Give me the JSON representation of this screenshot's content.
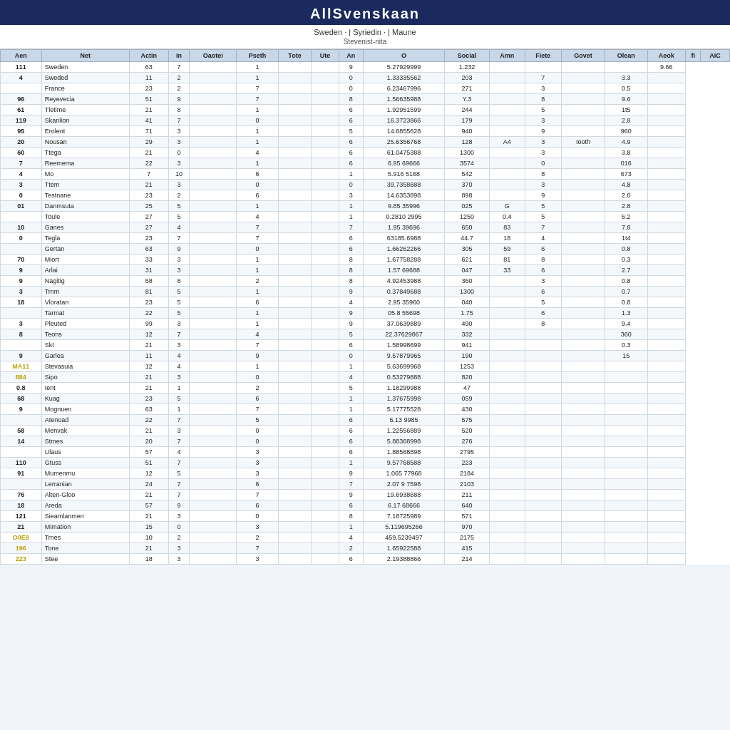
{
  "header": {
    "title": "AllSvenskaan",
    "subtitle": "Sweden  ·  |  Syriedin  ·  |  Maune",
    "subtitle2": "Stevenist-nita"
  },
  "columns": [
    "Aen",
    "Net",
    "Actin",
    "In",
    "Oaotei",
    "Pseth",
    "Tote",
    "Ute",
    "An",
    "O",
    "Social",
    "Amn",
    "Fiete",
    "Govet",
    "Olean",
    "Aeok",
    "fi",
    "AIC"
  ],
  "rows": [
    {
      "rank": "111",
      "name": "Sweden",
      "c1": "63",
      "c2": "7",
      "c3": "",
      "c4": "1",
      "c5": "",
      "c6": "",
      "c7": "9",
      "c8": "5.27929999",
      "c9": "1.232",
      "c10": "",
      "c11": "",
      "c12": "",
      "c13": "",
      "c14": "9.66"
    },
    {
      "rank": "4",
      "name": "Sweded",
      "c1": "11",
      "c2": "2",
      "c3": "",
      "c4": "1",
      "c5": "",
      "c6": "",
      "c7": "0",
      "c8": "1.33335562",
      "c9": "203",
      "c10": "",
      "c11": "7",
      "c12": "",
      "c13": "3.3"
    },
    {
      "rank": "",
      "name": "France",
      "c1": "23",
      "c2": "2",
      "c3": "",
      "c4": "7",
      "c5": "",
      "c6": "",
      "c7": "0",
      "c8": "6.23467996",
      "c9": "271",
      "c10": "",
      "c11": "3",
      "c12": "",
      "c13": "0.5"
    },
    {
      "rank": "96",
      "name": "Reyevecia",
      "c1": "51",
      "c2": "9",
      "c3": "",
      "c4": "7",
      "c5": "",
      "c6": "",
      "c7": "8",
      "c8": "1.56635988",
      "c9": "Y.3",
      "c10": "",
      "c11": "8",
      "c12": "",
      "c13": "9.6"
    },
    {
      "rank": "61",
      "name": "Tletime",
      "c1": "21",
      "c2": "8",
      "c3": "",
      "c4": "1",
      "c5": "",
      "c6": "",
      "c7": "6",
      "c8": "1.92951599",
      "c9": "244",
      "c10": "",
      "c11": "5",
      "c12": "",
      "c13": "1t5"
    },
    {
      "rank": "119",
      "name": "Skanlion",
      "c1": "41",
      "c2": "7",
      "c3": "",
      "c4": "0",
      "c5": "",
      "c6": "",
      "c7": "6",
      "c8": "16.3723866",
      "c9": "179",
      "c10": "",
      "c11": "3",
      "c12": "",
      "c13": "2.8"
    },
    {
      "rank": "95",
      "name": "Erolent",
      "c1": "71",
      "c2": "3",
      "c3": "",
      "c4": "1",
      "c5": "",
      "c6": "",
      "c7": "5",
      "c8": "14.6855628",
      "c9": "940",
      "c10": "",
      "c11": "9",
      "c12": "",
      "c13": "960"
    },
    {
      "rank": "20",
      "name": "Nousan",
      "c1": "29",
      "c2": "3",
      "c3": "",
      "c4": "1",
      "c5": "",
      "c6": "",
      "c7": "6",
      "c8": "25.6356768",
      "c9": "128",
      "c10": "A4",
      "c11": "3",
      "c12": "Iooth",
      "c13": "4.9"
    },
    {
      "rank": "60",
      "name": "Ttega",
      "c1": "21",
      "c2": "0",
      "c3": "",
      "c4": "4",
      "c5": "",
      "c6": "",
      "c7": "6",
      "c8": "61.0475388",
      "c9": "1300",
      "c10": "",
      "c11": "3",
      "c12": "",
      "c13": "3.8"
    },
    {
      "rank": "7",
      "name": "Reemema",
      "c1": "22",
      "c2": "3",
      "c3": "",
      "c4": "1",
      "c5": "",
      "c6": "",
      "c7": "6",
      "c8": "6.95 69666",
      "c9": "3574",
      "c10": "",
      "c11": "0",
      "c12": "",
      "c13": "016"
    },
    {
      "rank": "4",
      "name": "Mo",
      "c1": "7",
      "c2": "10",
      "c3": "",
      "c4": "6",
      "c5": "",
      "c6": "",
      "c7": "1",
      "c8": "5.916 5168",
      "c9": "542",
      "c10": "",
      "c11": "8",
      "c12": "",
      "c13": "673"
    },
    {
      "rank": "3",
      "name": "Ttem",
      "c1": "21",
      "c2": "3",
      "c3": "",
      "c4": "0",
      "c5": "",
      "c6": "",
      "c7": "0",
      "c8": "39.7358688",
      "c9": "370",
      "c10": "",
      "c11": "3",
      "c12": "",
      "c13": "4.8"
    },
    {
      "rank": "0",
      "name": "Testnane",
      "c1": "23",
      "c2": "2",
      "c3": "",
      "c4": "6",
      "c5": "",
      "c6": "",
      "c7": "3",
      "c8": "14.6353898",
      "c9": "898",
      "c10": "",
      "c11": "9",
      "c12": "",
      "c13": "2.0"
    },
    {
      "rank": "01",
      "name": "Danmsuta",
      "c1": "25",
      "c2": "5",
      "c3": "",
      "c4": "1",
      "c5": "",
      "c6": "",
      "c7": "1",
      "c8": "9.85 35996",
      "c9": "025",
      "c10": "G",
      "c11": "5",
      "c12": "",
      "c13": "2.8"
    },
    {
      "rank": "",
      "name": "Toule",
      "c1": "27",
      "c2": "5",
      "c3": "",
      "c4": "4",
      "c5": "",
      "c6": "",
      "c7": "1",
      "c8": "0.2810 2995",
      "c9": "1250",
      "c10": "0.4",
      "c11": "5",
      "c12": "",
      "c13": "6.2"
    },
    {
      "rank": "10",
      "name": "Ganes",
      "c1": "27",
      "c2": "4",
      "c3": "",
      "c4": "7",
      "c5": "",
      "c6": "",
      "c7": "7",
      "c8": "1.95 39696",
      "c9": "650",
      "c10": "83",
      "c11": "7",
      "c12": "",
      "c13": "7.8"
    },
    {
      "rank": "0",
      "name": "Tegla",
      "c1": "23",
      "c2": "7",
      "c3": "",
      "c4": "7",
      "c5": "",
      "c6": "",
      "c7": "6",
      "c8": "63185.6988",
      "c9": "44.7",
      "c10": "18",
      "c11": "4",
      "c12": "",
      "c13": "1t4"
    },
    {
      "rank": "",
      "name": "Gertan",
      "c1": "63",
      "c2": "9",
      "c3": "",
      "c4": "0",
      "c5": "",
      "c6": "",
      "c7": "6",
      "c8": "1.66262266",
      "c9": "305",
      "c10": "59",
      "c11": "6",
      "c12": "",
      "c13": "0.8"
    },
    {
      "rank": "70",
      "name": "Miort",
      "c1": "33",
      "c2": "3",
      "c3": "",
      "c4": "1",
      "c5": "",
      "c6": "",
      "c7": "8",
      "c8": "1.67758288",
      "c9": "621",
      "c10": "81",
      "c11": "8",
      "c12": "",
      "c13": "0.3"
    },
    {
      "rank": "9",
      "name": "Arlai",
      "c1": "31",
      "c2": "3",
      "c3": "",
      "c4": "1",
      "c5": "",
      "c6": "",
      "c7": "8",
      "c8": "1.57 69688",
      "c9": "047",
      "c10": "33",
      "c11": "6",
      "c12": "",
      "c13": "2.7"
    },
    {
      "rank": "9",
      "name": "Nagitig",
      "c1": "58",
      "c2": "8",
      "c3": "",
      "c4": "2",
      "c5": "",
      "c6": "",
      "c7": "8",
      "c8": "4.92453988",
      "c9": "360",
      "c10": "",
      "c11": "3",
      "c12": "",
      "c13": "0.8"
    },
    {
      "rank": "3",
      "name": "Trnm",
      "c1": "81",
      "c2": "5",
      "c3": "",
      "c4": "1",
      "c5": "",
      "c6": "",
      "c7": "9",
      "c8": "0.37849688",
      "c9": "1300",
      "c10": "",
      "c11": "6",
      "c12": "",
      "c13": "0.7"
    },
    {
      "rank": "18",
      "name": "Vloratan",
      "c1": "23",
      "c2": "5",
      "c3": "",
      "c4": "6",
      "c5": "",
      "c6": "",
      "c7": "4",
      "c8": "2.95 35960",
      "c9": "040",
      "c10": "",
      "c11": "5",
      "c12": "",
      "c13": "0.8"
    },
    {
      "rank": "",
      "name": "Tarmat",
      "c1": "22",
      "c2": "5",
      "c3": "",
      "c4": "1",
      "c5": "",
      "c6": "",
      "c7": "9",
      "c8": "05.8 55698",
      "c9": "1.75",
      "c10": "",
      "c11": "6",
      "c12": "",
      "c13": "1.3"
    },
    {
      "rank": "3",
      "name": "Pleuted",
      "c1": "99",
      "c2": "3",
      "c3": "",
      "c4": "1",
      "c5": "",
      "c6": "",
      "c7": "9",
      "c8": "37.0639889",
      "c9": "490",
      "c10": "",
      "c11": "8",
      "c12": "",
      "c13": "9.4"
    },
    {
      "rank": "8",
      "name": "Teons",
      "c1": "12",
      "c2": "7",
      "c3": "",
      "c4": "4",
      "c5": "",
      "c6": "",
      "c7": "5",
      "c8": "22.37629867",
      "c9": "332",
      "c10": "",
      "c11": "",
      "c12": "",
      "c13": "360"
    },
    {
      "rank": "",
      "name": "Skt",
      "c1": "21",
      "c2": "3",
      "c3": "",
      "c4": "7",
      "c5": "",
      "c6": "",
      "c7": "6",
      "c8": "1.58998699",
      "c9": "941",
      "c10": "",
      "c11": "",
      "c12": "",
      "c13": "0.3"
    },
    {
      "rank": "9",
      "name": "Garlea",
      "c1": "11",
      "c2": "4",
      "c3": "",
      "c4": "9",
      "c5": "",
      "c6": "",
      "c7": "0",
      "c8": "9.57879965",
      "c9": "190",
      "c10": "",
      "c11": "",
      "c12": "",
      "c13": "15"
    },
    {
      "rank": "MA11",
      "name": "Stevasuia",
      "c1": "12",
      "c2": "4",
      "c3": "",
      "c4": "1",
      "c5": "",
      "c6": "",
      "c7": "1",
      "c8": "5.63699968",
      "c9": "1253",
      "c10": "",
      "c11": "",
      "c12": "",
      "c13": ""
    },
    {
      "rank": "884",
      "name": "Sipo",
      "c1": "21",
      "c2": "3",
      "c3": "",
      "c4": "0",
      "c5": "",
      "c6": "",
      "c7": "4",
      "c8": "0.53279888",
      "c9": "820",
      "c10": "",
      "c11": "",
      "c12": "",
      "c13": ""
    },
    {
      "rank": "0.8",
      "name": "Ient",
      "c1": "21",
      "c2": "1",
      "c3": "",
      "c4": "2",
      "c5": "",
      "c6": "",
      "c7": "5",
      "c8": "1.18299988",
      "c9": "47",
      "c10": "",
      "c11": "",
      "c12": "",
      "c13": ""
    },
    {
      "rank": "68",
      "name": "Kuag",
      "c1": "23",
      "c2": "5",
      "c3": "",
      "c4": "6",
      "c5": "",
      "c6": "",
      "c7": "1",
      "c8": "1.37675998",
      "c9": "059",
      "c10": "",
      "c11": "",
      "c12": "",
      "c13": ""
    },
    {
      "rank": "9",
      "name": "Mognuen",
      "c1": "63",
      "c2": "1",
      "c3": "",
      "c4": "7",
      "c5": "",
      "c6": "",
      "c7": "1",
      "c8": "5.17775528",
      "c9": "430",
      "c10": "",
      "c11": "",
      "c12": "",
      "c13": ""
    },
    {
      "rank": "",
      "name": "Atenoad",
      "c1": "22",
      "c2": "7",
      "c3": "",
      "c4": "5",
      "c5": "",
      "c6": "",
      "c7": "6",
      "c8": "6.13 9985",
      "c9": "575",
      "c10": "",
      "c11": "",
      "c12": "",
      "c13": ""
    },
    {
      "rank": "58",
      "name": "Menvak",
      "c1": "21",
      "c2": "3",
      "c3": "",
      "c4": "0",
      "c5": "",
      "c6": "",
      "c7": "6",
      "c8": "1.22556889",
      "c9": "520",
      "c10": "",
      "c11": "",
      "c12": "",
      "c13": ""
    },
    {
      "rank": "14",
      "name": "Stmes",
      "c1": "20",
      "c2": "7",
      "c3": "",
      "c4": "0",
      "c5": "",
      "c6": "",
      "c7": "6",
      "c8": "5.88368998",
      "c9": "276",
      "c10": "",
      "c11": "",
      "c12": "",
      "c13": ""
    },
    {
      "rank": "",
      "name": "Ulaus",
      "c1": "57",
      "c2": "4",
      "c3": "",
      "c4": "3",
      "c5": "",
      "c6": "",
      "c7": "6",
      "c8": "1.88568898",
      "c9": "2795",
      "c10": "",
      "c11": "",
      "c12": "",
      "c13": ""
    },
    {
      "rank": "110",
      "name": "Gtuss",
      "c1": "51",
      "c2": "7",
      "c3": "",
      "c4": "3",
      "c5": "",
      "c6": "",
      "c7": "1",
      "c8": "9.57768588",
      "c9": "223",
      "c10": "",
      "c11": "",
      "c12": "",
      "c13": ""
    },
    {
      "rank": "91",
      "name": "Mumenmu",
      "c1": "12",
      "c2": "5",
      "c3": "",
      "c4": "3",
      "c5": "",
      "c6": "",
      "c7": "9",
      "c8": "1.065 77968",
      "c9": "2184",
      "c10": "",
      "c11": "",
      "c12": "",
      "c13": ""
    },
    {
      "rank": "",
      "name": "Lerranian",
      "c1": "24",
      "c2": "7",
      "c3": "",
      "c4": "6",
      "c5": "",
      "c6": "",
      "c7": "7",
      "c8": "2.07 9 7598",
      "c9": "2103",
      "c10": "",
      "c11": "",
      "c12": "",
      "c13": ""
    },
    {
      "rank": "76",
      "name": "Alten-Gloo",
      "c1": "21",
      "c2": "7",
      "c3": "",
      "c4": "7",
      "c5": "",
      "c6": "",
      "c7": "9",
      "c8": "19.6938688",
      "c9": "211",
      "c10": "",
      "c11": "",
      "c12": "",
      "c13": ""
    },
    {
      "rank": "18",
      "name": "Areda",
      "c1": "57",
      "c2": "9",
      "c3": "",
      "c4": "6",
      "c5": "",
      "c6": "",
      "c7": "6",
      "c8": "6.17 68666",
      "c9": "640",
      "c10": "",
      "c11": "",
      "c12": "",
      "c13": ""
    },
    {
      "rank": "121",
      "name": "Sieamlanmen",
      "c1": "21",
      "c2": "3",
      "c3": "",
      "c4": "0",
      "c5": "",
      "c6": "",
      "c7": "8",
      "c8": "7.18725989",
      "c9": "571",
      "c10": "",
      "c11": "",
      "c12": "",
      "c13": ""
    },
    {
      "rank": "21",
      "name": "Mimation",
      "c1": "15",
      "c2": "0",
      "c3": "",
      "c4": "3",
      "c5": "",
      "c6": "",
      "c7": "1",
      "c8": "5.119695266",
      "c9": "970",
      "c10": "",
      "c11": "",
      "c12": "",
      "c13": ""
    },
    {
      "rank": "O0E8",
      "name": "Trnes",
      "c1": "10",
      "c2": "2",
      "c3": "",
      "c4": "2",
      "c5": "",
      "c6": "",
      "c7": "4",
      "c8": "459.5239497",
      "c9": "2175",
      "c10": "",
      "c11": "",
      "c12": "",
      "c13": ""
    },
    {
      "rank": "196",
      "name": "Tone",
      "c1": "21",
      "c2": "3",
      "c3": "",
      "c4": "7",
      "c5": "",
      "c6": "",
      "c7": "2",
      "c8": "1.65922588",
      "c9": "415",
      "c10": "",
      "c11": "",
      "c12": "",
      "c13": ""
    },
    {
      "rank": "223",
      "name": "Stee",
      "c1": "18",
      "c2": "3",
      "c3": "",
      "c4": "3",
      "c5": "",
      "c6": "",
      "c7": "6",
      "c8": "2.19388866",
      "c9": "214",
      "c10": "",
      "c11": "",
      "c12": "",
      "c13": ""
    }
  ]
}
